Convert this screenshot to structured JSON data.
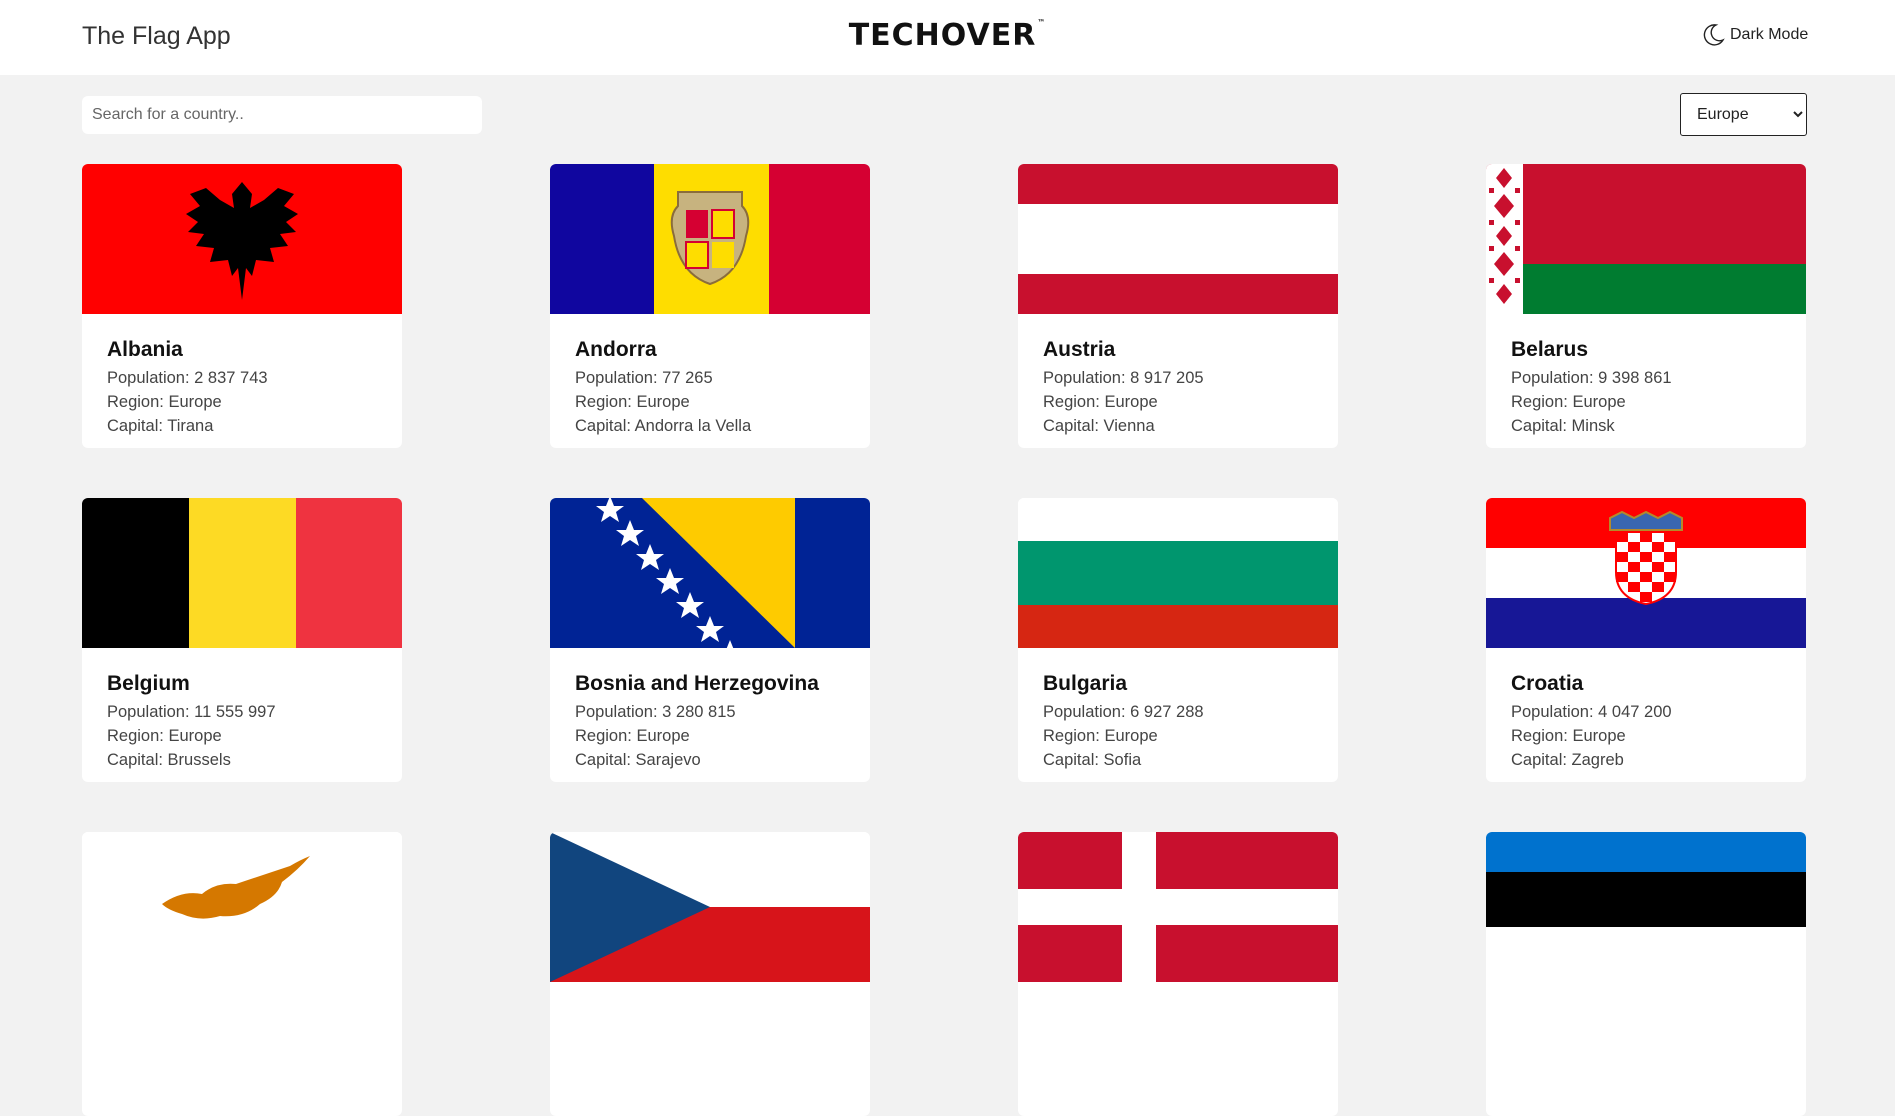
{
  "header": {
    "app_title": "The Flag App",
    "brand": "TECHOVER",
    "brand_mark": "™",
    "dark_mode_label": "Dark Mode",
    "dark_mode_icon": "moon-icon"
  },
  "search": {
    "placeholder": "Search for a country.."
  },
  "filter": {
    "selected": "Europe",
    "options": [
      "Europe"
    ]
  },
  "labels": {
    "population": "Population:",
    "region": "Region:",
    "capital": "Capital:"
  },
  "countries": [
    {
      "name": "Albania",
      "population": "2 837 743",
      "region": "Europe",
      "capital": "Tirana"
    },
    {
      "name": "Andorra",
      "population": "77 265",
      "region": "Europe",
      "capital": "Andorra la Vella"
    },
    {
      "name": "Austria",
      "population": "8 917 205",
      "region": "Europe",
      "capital": "Vienna"
    },
    {
      "name": "Belarus",
      "population": "9 398 861",
      "region": "Europe",
      "capital": "Minsk"
    },
    {
      "name": "Belgium",
      "population": "11 555 997",
      "region": "Europe",
      "capital": "Brussels"
    },
    {
      "name": "Bosnia and Herzegovina",
      "population": "3 280 815",
      "region": "Europe",
      "capital": "Sarajevo"
    },
    {
      "name": "Bulgaria",
      "population": "6 927 288",
      "region": "Europe",
      "capital": "Sofia"
    },
    {
      "name": "Croatia",
      "population": "4 047 200",
      "region": "Europe",
      "capital": "Zagreb"
    }
  ],
  "partial_flags": [
    "cyprus-flag",
    "czechia-flag",
    "denmark-flag",
    "estonia-flag"
  ],
  "colors": {
    "page_bg": "#f2f2f2",
    "card_bg": "#ffffff"
  }
}
